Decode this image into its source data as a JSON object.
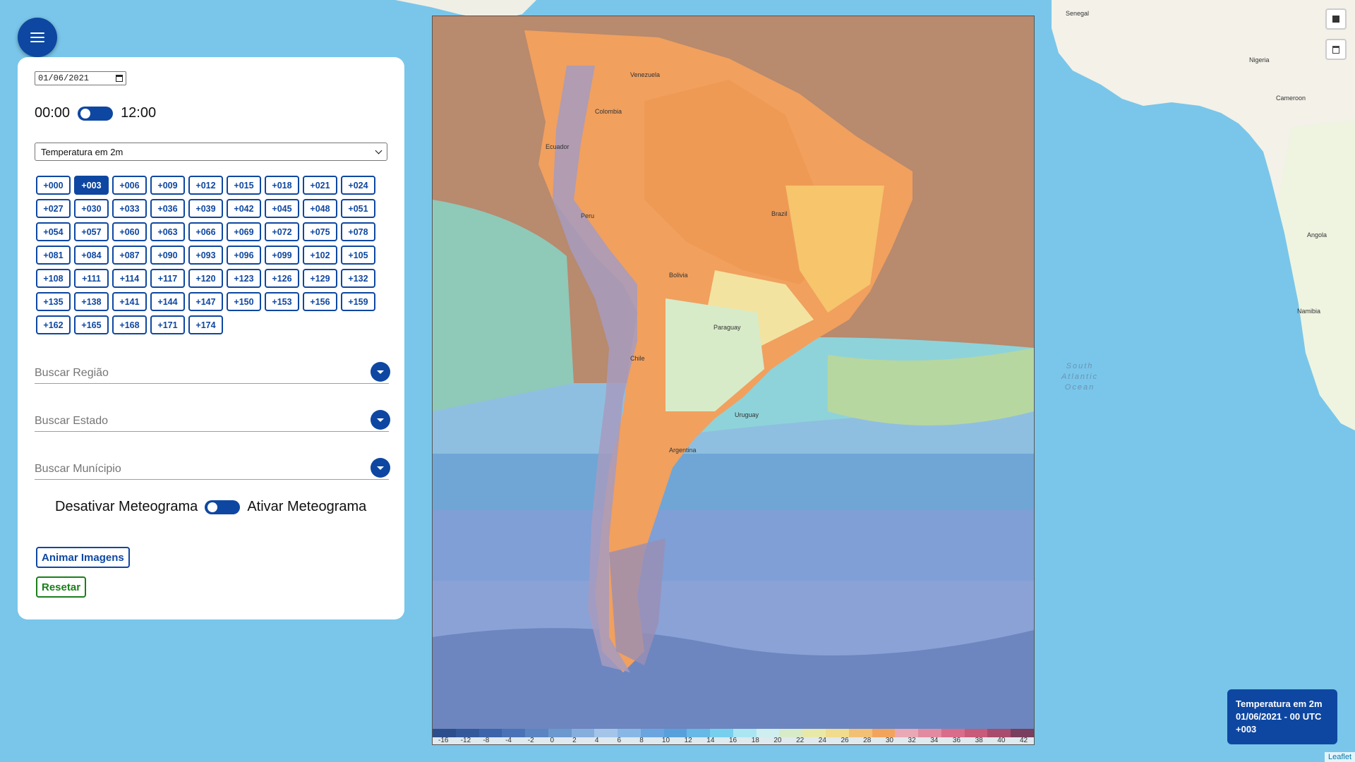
{
  "menu": {
    "icon": "menu-icon"
  },
  "panel": {
    "date_value": "01/06/2021",
    "time_left": "00:00",
    "time_right": "12:00",
    "product_selected": "Temperatura em 2m",
    "hours": [
      "+000",
      "+003",
      "+006",
      "+009",
      "+012",
      "+015",
      "+018",
      "+021",
      "+024",
      "+027",
      "+030",
      "+033",
      "+036",
      "+039",
      "+042",
      "+045",
      "+048",
      "+051",
      "+054",
      "+057",
      "+060",
      "+063",
      "+066",
      "+069",
      "+072",
      "+075",
      "+078",
      "+081",
      "+084",
      "+087",
      "+090",
      "+093",
      "+096",
      "+099",
      "+102",
      "+105",
      "+108",
      "+111",
      "+114",
      "+117",
      "+120",
      "+123",
      "+126",
      "+129",
      "+132",
      "+135",
      "+138",
      "+141",
      "+144",
      "+147",
      "+150",
      "+153",
      "+156",
      "+159",
      "+162",
      "+165",
      "+168",
      "+171",
      "+174"
    ],
    "active_hour": "+003",
    "search_region": "Buscar Região",
    "search_state": "Buscar Estado",
    "search_city": "Buscar Munícipio",
    "meteo_off": "Desativar Meteograma",
    "meteo_on": "Ativar Meteograma",
    "animate_label": "Animar Imagens",
    "reset_label": "Resetar"
  },
  "colorbar": {
    "ticks": [
      "-16",
      "-12",
      "-8",
      "-4",
      "-2",
      "0",
      "2",
      "4",
      "6",
      "8",
      "10",
      "12",
      "14",
      "16",
      "18",
      "20",
      "22",
      "24",
      "26",
      "28",
      "30",
      "32",
      "34",
      "36",
      "38",
      "40",
      "42"
    ],
    "colors": [
      "#2d4e8c",
      "#34599b",
      "#3c64ab",
      "#4a72b7",
      "#5a85c2",
      "#6b98cf",
      "#86aedc",
      "#a4c4e8",
      "#88b7e6",
      "#6aa5e0",
      "#58a0dc",
      "#66b8e6",
      "#77cfee",
      "#a9e6f2",
      "#cfeef0",
      "#d7ebc9",
      "#e8e9a8",
      "#f0dc8c",
      "#f2c074",
      "#f2a45c",
      "#e9a8b4",
      "#e28aa0",
      "#d96c8a",
      "#c85a7a",
      "#a84b6c",
      "#7a3e5e"
    ]
  },
  "info": {
    "line1": "Temperatura em 2m",
    "line2": "01/06/2021 - 00 UTC",
    "line3": "+003"
  },
  "map_labels": {
    "colombia": "Colombia",
    "venezuela": "Venezuela",
    "brazil": "Brazil",
    "bolivia": "Bolivia",
    "paraguay": "Paraguay",
    "uruguay": "Uruguay",
    "argentina": "Argentina",
    "peru": "Peru",
    "ecuador": "Ecuador",
    "chile": "Chile",
    "senegal": "Senegal",
    "nigeria": "Nigeria",
    "cameroon": "Cameroon",
    "angola": "Angola",
    "namibia": "Namibia",
    "south_atlantic": "South\nAtlantic\nOcean"
  },
  "attribution": "Leaflet",
  "colors": {
    "accent": "#0e47a1",
    "reset": "#1a7f1a",
    "ocean": "#79c6ea"
  }
}
